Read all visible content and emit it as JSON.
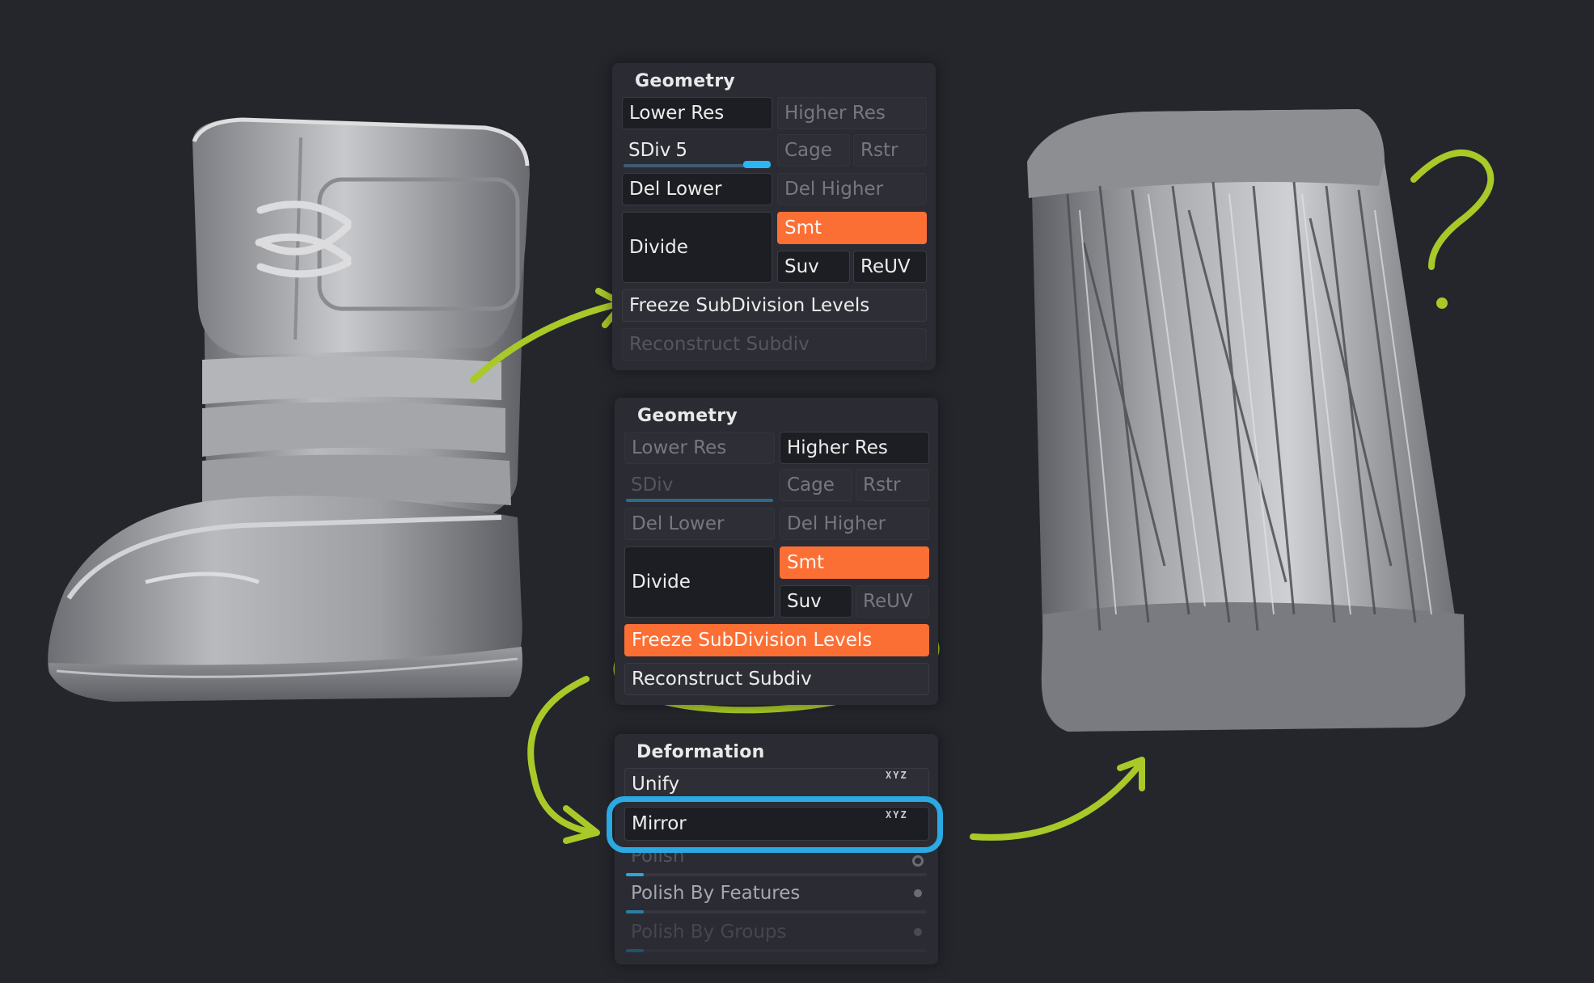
{
  "geometry_panel_top": {
    "title": "Geometry",
    "lower_res": "Lower Res",
    "higher_res": "Higher Res",
    "sdiv_label": "SDiv",
    "sdiv_value": "5",
    "sdiv_level": 0.85,
    "cage": "Cage",
    "rstr": "Rstr",
    "del_lower": "Del Lower",
    "del_higher": "Del Higher",
    "divide": "Divide",
    "smt": "Smt",
    "suv": "Suv",
    "reuv": "ReUV",
    "freeze": "Freeze SubDivision Levels",
    "reconstruct": "Reconstruct Subdiv"
  },
  "geometry_panel_bottom": {
    "title": "Geometry",
    "lower_res": "Lower Res",
    "higher_res": "Higher Res",
    "sdiv_label": "SDiv",
    "sdiv_level": 0.0,
    "cage": "Cage",
    "rstr": "Rstr",
    "del_lower": "Del Lower",
    "del_higher": "Del Higher",
    "divide": "Divide",
    "smt": "Smt",
    "suv": "Suv",
    "reuv": "ReUV",
    "freeze": "Freeze SubDivision Levels",
    "reconstruct": "Reconstruct Subdiv"
  },
  "deformation_panel": {
    "title": "Deformation",
    "unify": "Unify",
    "mirror": "Mirror",
    "axes": "XYZ",
    "polish": "Polish",
    "polish_by_features": "Polish By Features",
    "polish_by_groups": "Polish By Groups"
  },
  "annotations": {
    "question_mark": "?",
    "highlight_green": "#a8c928",
    "highlight_blue": "#2aa9e3"
  },
  "colors": {
    "background": "#25262c",
    "panel": "#2b2c33",
    "accent_orange": "#fb6f35",
    "slider_blue": "#29a7e1"
  }
}
